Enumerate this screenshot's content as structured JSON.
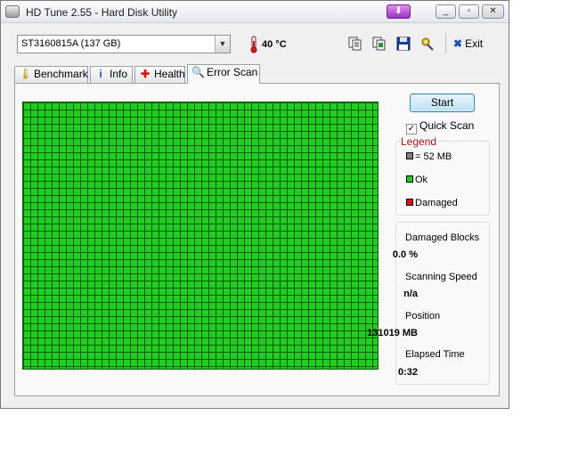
{
  "window": {
    "title": "HD Tune 2.55 - Hard Disk Utility"
  },
  "titlebar_buttons": {
    "minimize": "_",
    "restore": "▫",
    "close": "✕"
  },
  "toolbar": {
    "drive": "ST3160815A (137 GB)",
    "temperature": "40 °C",
    "exit_label": "Exit",
    "icons": [
      "copy-text-icon",
      "copy-screenshot-icon",
      "save-icon",
      "options-icon"
    ]
  },
  "tabs": [
    {
      "label": "Benchmark",
      "icon": "benchmark-icon",
      "active": false
    },
    {
      "label": "Info",
      "icon": "info-icon",
      "active": false
    },
    {
      "label": "Health",
      "icon": "health-icon",
      "active": false
    },
    {
      "label": "Error Scan",
      "icon": "error-scan-icon",
      "active": true
    }
  ],
  "scan": {
    "start_label": "Start",
    "quick_scan_label": "Quick Scan",
    "quick_scan_checked": true,
    "grid_color_ok": "#22cc22"
  },
  "legend": {
    "title": "Legend",
    "items": [
      {
        "label": "= 52 MB",
        "color": "#808080"
      },
      {
        "label": "Ok",
        "color": "#22cc22"
      },
      {
        "label": "Damaged",
        "color": "#e01010"
      }
    ]
  },
  "stats": {
    "damaged_blocks_label": "Damaged Blocks",
    "damaged_blocks_value": "0.0 %",
    "scanning_speed_label": "Scanning Speed",
    "scanning_speed_value": "n/a",
    "position_label": "Position",
    "position_value": "131019 MB",
    "elapsed_time_label": "Elapsed Time",
    "elapsed_time_value": "0:32"
  }
}
